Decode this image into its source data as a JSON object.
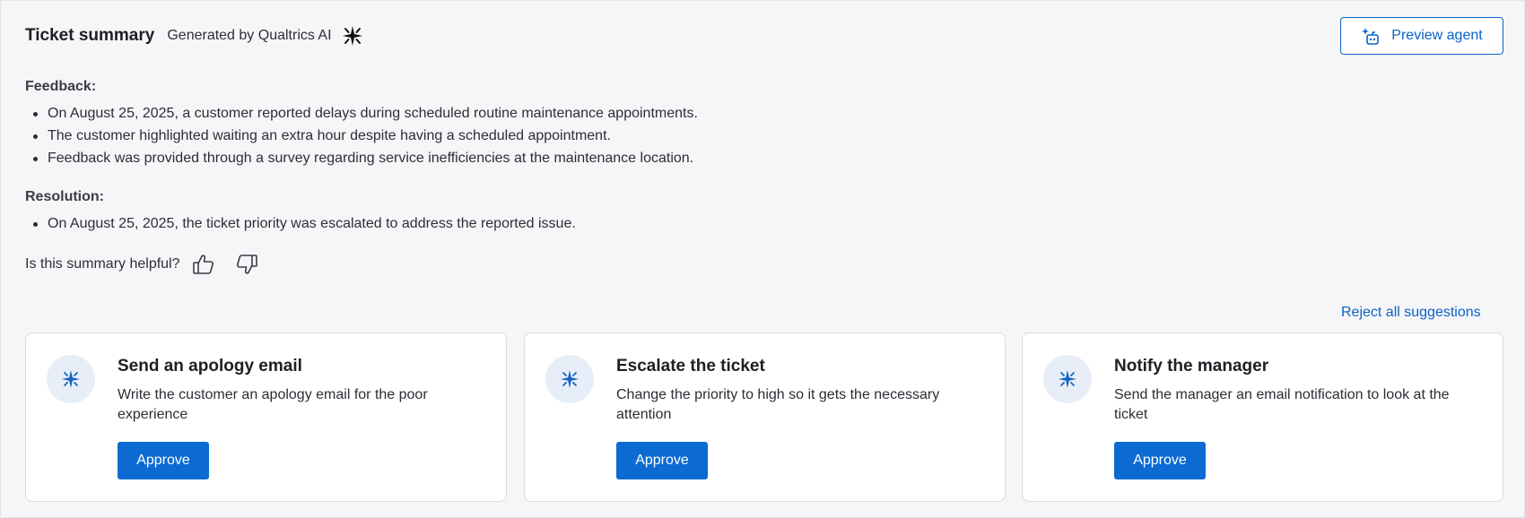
{
  "header": {
    "title": "Ticket summary",
    "generated_by": "Generated by Qualtrics AI",
    "ai_icon": "sparkle-icon",
    "preview_button_label": "Preview agent",
    "preview_button_icon": "agent-sparkle-icon"
  },
  "summary": {
    "feedback": {
      "label": "Feedback:",
      "items": [
        "On August 25, 2025, a customer reported delays during scheduled routine maintenance appointments.",
        "The customer highlighted waiting an extra hour despite having a scheduled appointment.",
        "Feedback was provided through a survey regarding service inefficiencies at the maintenance location."
      ]
    },
    "resolution": {
      "label": "Resolution:",
      "items": [
        "On August 25, 2025, the ticket priority was escalated to address the reported issue."
      ]
    },
    "helpful_prompt": "Is this summary helpful?"
  },
  "suggestions": {
    "reject_all_label": "Reject all suggestions",
    "cards": [
      {
        "title": "Send an apology email",
        "description": "Write the customer an apology email for the poor experience",
        "button_label": "Approve",
        "icon": "sparkle-icon"
      },
      {
        "title": "Escalate the ticket",
        "description": "Change the priority to high so it gets the necessary attention",
        "button_label": "Approve",
        "icon": "sparkle-icon"
      },
      {
        "title": "Notify the manager",
        "description": "Send the manager an email notification to look at the ticket",
        "button_label": "Approve",
        "icon": "sparkle-icon"
      }
    ]
  },
  "colors": {
    "accent": "#0b62c9",
    "approve_button": "#0b6bd3",
    "page_background": "#f6f6f8",
    "card_background": "#ffffff",
    "icon_circle": "#e8eef8"
  }
}
